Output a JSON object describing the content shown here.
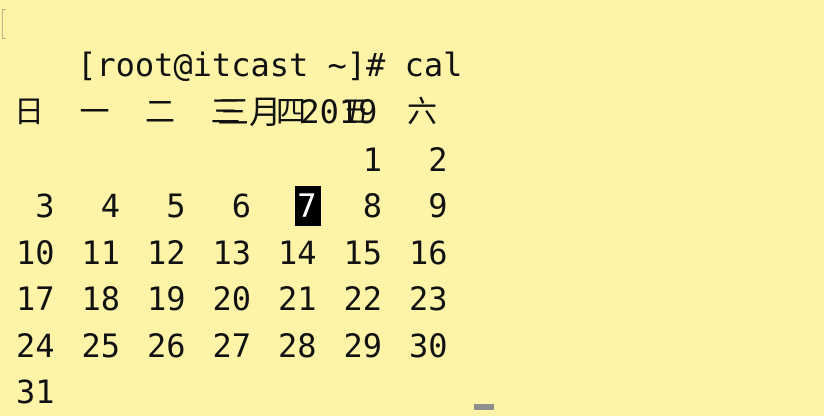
{
  "terminal": {
    "prompt_line": "[root@itcast ~]# cal",
    "calendar_title": "三月 2019",
    "weekday_headers": [
      "日",
      "一",
      "二",
      "三",
      "四",
      "五",
      "六"
    ],
    "weeks": [
      [
        "",
        "",
        "",
        "",
        "",
        "1",
        "2"
      ],
      [
        "3",
        "4",
        "5",
        "6",
        "7",
        "8",
        "9"
      ],
      [
        "10",
        "11",
        "12",
        "13",
        "14",
        "15",
        "16"
      ],
      [
        "17",
        "18",
        "19",
        "20",
        "21",
        "22",
        "23"
      ],
      [
        "24",
        "25",
        "26",
        "27",
        "28",
        "29",
        "30"
      ],
      [
        "31",
        "",
        "",
        "",
        "",
        "",
        ""
      ]
    ],
    "highlighted_day": "7"
  },
  "colors": {
    "background": "#fdf4a8",
    "text": "#111111",
    "highlight_bg": "#000000",
    "highlight_fg": "#ffffff"
  }
}
